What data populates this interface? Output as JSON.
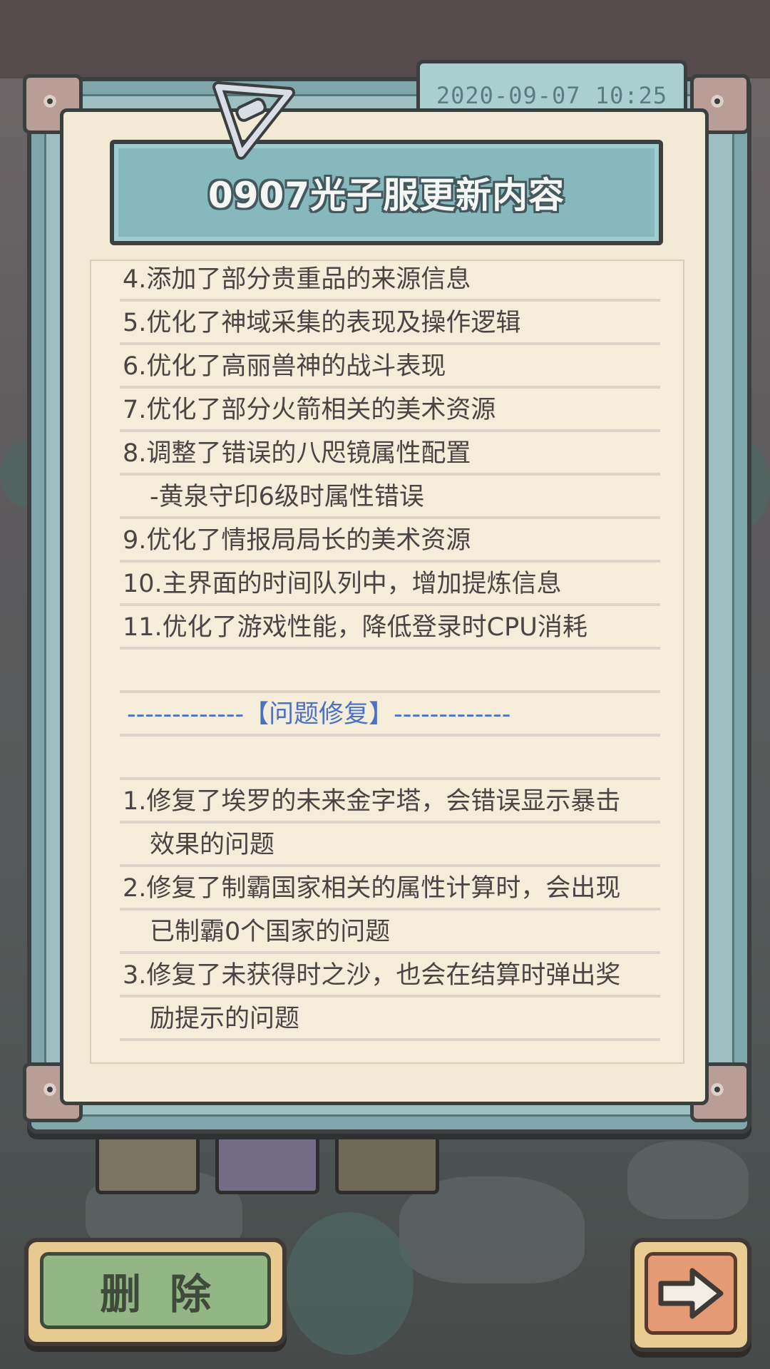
{
  "notice": {
    "timestamp": "2020-09-07  10:25",
    "title": "0907光子服更新内容",
    "lines": [
      "4.添加了部分贵重品的来源信息",
      "5.优化了神域采集的表现及操作逻辑",
      "6.优化了高丽兽神的战斗表现",
      "7.优化了部分火箭相关的美术资源",
      "8.调整了错误的八咫镜属性配置",
      "-黄泉守印6级时属性错误",
      "9.优化了情报局局长的美术资源",
      "10.主界面的时间队列中，增加提炼信息",
      "11.优化了游戏性能，降低登录时CPU消耗",
      "",
      "-------------【问题修复】-------------",
      "",
      "1.修复了埃罗的未来金字塔，会错误显示暴击",
      "效果的问题",
      "2.修复了制霸国家相关的属性计算时，会出现",
      "已制霸0个国家的问题",
      "3.修复了未获得时之沙，也会在结算时弹出奖",
      "励提示的问题"
    ]
  },
  "buttons": {
    "delete_label": "删除",
    "next_icon": "arrow-right-icon"
  },
  "colors": {
    "section_header": "#4a72c4",
    "paper": "#f3ead6",
    "frame": "#7fa7ab"
  }
}
